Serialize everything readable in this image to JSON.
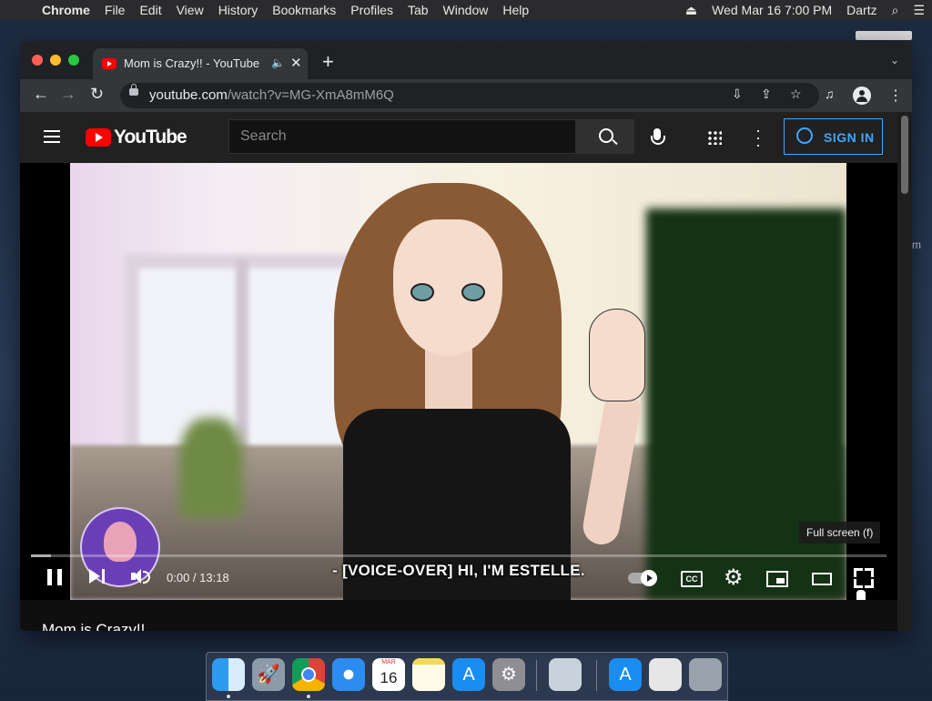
{
  "menubar": {
    "apple": "",
    "app": "Chrome",
    "items": [
      "File",
      "Edit",
      "View",
      "History",
      "Bookmarks",
      "Profiles",
      "Tab",
      "Window",
      "Help"
    ],
    "clock": "Wed Mar 16  7:00 PM",
    "user": "Dartz"
  },
  "desktop": {
    "edge_letter": "m"
  },
  "browser": {
    "tab": {
      "title": "Mom is Crazy!! - YouTube",
      "close": "✕"
    },
    "new_tab": "+",
    "url_host": "youtube.com",
    "url_path": "/watch?v=MG-XmA8mM6Q"
  },
  "youtube": {
    "logo_text": "YouTube",
    "search_placeholder": "Search",
    "sign_in": "SIGN IN",
    "player": {
      "caption": "- [VOICE-OVER] HI, I'M ESTELLE.",
      "time": "0:00 / 13:18",
      "tooltip": "Full screen (f)",
      "cc_label": "CC",
      "progress_fraction": 0.0
    },
    "video_title": "Mom is Crazy!!"
  },
  "dock": {
    "calendar_day": "16",
    "apps": [
      "Finder",
      "Launchpad",
      "Google Chrome",
      "Safari",
      "Calendar",
      "Notes",
      "App Store",
      "System Preferences",
      "Preview",
      "App Store",
      "Files",
      "Trash"
    ]
  },
  "colors": {
    "youtube_red": "#ff0000",
    "signin_blue": "#3ea6ff",
    "page_bg": "#0f0f0f"
  }
}
